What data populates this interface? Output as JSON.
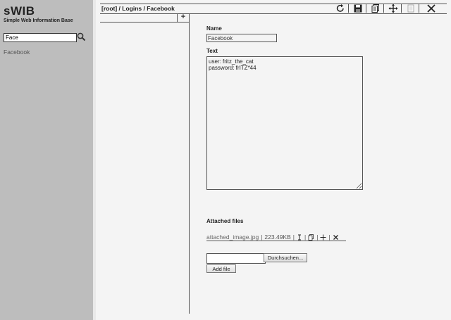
{
  "app": {
    "title": "sWIB",
    "subtitle": "Simple Web Information Base"
  },
  "search": {
    "value": "Face",
    "icon": "search-icon"
  },
  "results": [
    {
      "label": "Facebook"
    }
  ],
  "breadcrumb": "[root] / Logins / Facebook",
  "toolbar": {
    "icons": [
      "refresh-icon",
      "save-icon",
      "copy-icon",
      "move-icon",
      "paste-icon",
      "close-icon"
    ]
  },
  "tree": {
    "add_symbol": "+"
  },
  "entry": {
    "name_label": "Name",
    "name_value": "Facebook",
    "text_label": "Text",
    "text_value": "user: fritz_the_cat\npassword: frITZ*44"
  },
  "attachments": {
    "label": "Attached files",
    "files": [
      {
        "name": "attached_image.jpg",
        "size": "223.49KB"
      }
    ],
    "browse_label": "Durchsuchen...",
    "add_label": "Add file"
  }
}
